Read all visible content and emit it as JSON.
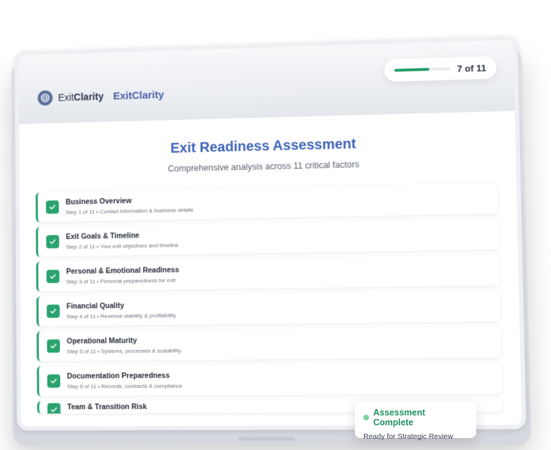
{
  "header": {
    "logo_text_regular": "Exit",
    "logo_text_bold": "Clarity",
    "brand_name": "ExitClarity",
    "progress": {
      "current": 7,
      "total": 11,
      "fraction": 0.636,
      "label": "7 of 11"
    }
  },
  "main": {
    "title": "Exit Readiness Assessment",
    "subtitle": "Comprehensive analysis across 11 critical factors",
    "steps": [
      {
        "title": "Business Overview",
        "sub": "Step 1 of 11 • Contact information & business details",
        "completed": true
      },
      {
        "title": "Exit Goals & Timeline",
        "sub": "Step 2 of 11 • Your exit objectives and timeline",
        "completed": true
      },
      {
        "title": "Personal & Emotional Readiness",
        "sub": "Step 3 of 11 • Personal preparedness for exit",
        "completed": true
      },
      {
        "title": "Financial Quality",
        "sub": "Step 4 of 11 • Revenue stability & profitability",
        "completed": true
      },
      {
        "title": "Operational Maturity",
        "sub": "Step 5 of 11 • Systems, processes & scalability",
        "completed": true
      },
      {
        "title": "Documentation Preparedness",
        "sub": "Step 6 of 11 • Records, contracts & compliance",
        "completed": true
      },
      {
        "title": "Team & Transition Risk",
        "sub": "",
        "completed": true
      }
    ]
  },
  "toast": {
    "title": "Assessment Complete",
    "subtitle": "Ready for Strategic Review",
    "status_color": "#7fd0a3"
  },
  "colors": {
    "accent_blue": "#3e63b8",
    "success_green": "#22a06b"
  }
}
